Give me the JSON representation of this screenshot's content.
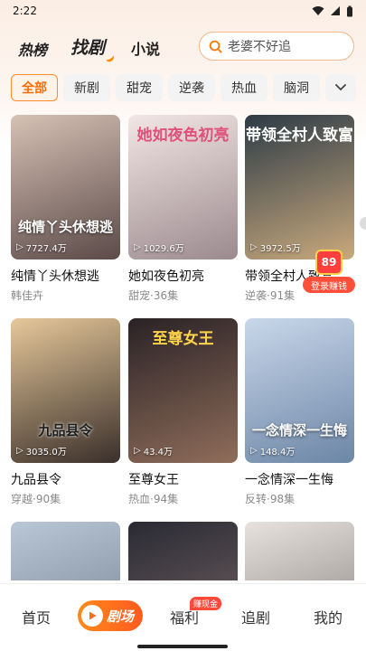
{
  "status": {
    "time": "2:22"
  },
  "header": {
    "tabs": [
      "热榜",
      "找剧",
      "小说"
    ],
    "search_placeholder": "老婆不好追"
  },
  "chips": [
    "全部",
    "新剧",
    "甜宠",
    "逆袭",
    "热血",
    "脑洞"
  ],
  "cards": [
    {
      "title": "纯情丫头休想逃",
      "meta": "韩佳卉",
      "views": "7727.4万",
      "poster_text": "纯情丫头休想逃",
      "colors": [
        "#d7c1b5",
        "#5b4a48"
      ]
    },
    {
      "title": "她如夜色初亮",
      "meta": "甜宠·36集",
      "views": "1029.6万",
      "poster_text": "她如夜色初亮",
      "colors": [
        "#f3e6e6",
        "#9b8a8e"
      ]
    },
    {
      "title": "带领全村人致富",
      "meta": "逆袭·91集",
      "views": "3972.5万",
      "poster_text": "带领全村人致富",
      "colors": [
        "#2d3b46",
        "#c9a97d"
      ]
    },
    {
      "title": "九品县令",
      "meta": "穿越·90集",
      "views": "3035.0万",
      "poster_text": "九品县令",
      "colors": [
        "#e6c89a",
        "#3a2f2a"
      ]
    },
    {
      "title": "至尊女王",
      "meta": "热血·94集",
      "views": "43.4万",
      "poster_text": "至尊女王",
      "colors": [
        "#2a2226",
        "#8f6d5a"
      ]
    },
    {
      "title": "一念情深一生悔",
      "meta": "反转·98集",
      "views": "148.4万",
      "poster_text": "一念情深一生悔",
      "colors": [
        "#c9d7ea",
        "#6c86a6"
      ]
    },
    {
      "title": "",
      "meta": "",
      "views": "",
      "poster_text": "",
      "colors": [
        "#b9c7d6",
        "#6f7d8e"
      ]
    },
    {
      "title": "",
      "meta": "",
      "views": "",
      "poster_text": "",
      "colors": [
        "#2a2a33",
        "#7a6a6a"
      ]
    },
    {
      "title": "",
      "meta": "",
      "views": "",
      "poster_text": "",
      "colors": [
        "#e8e2de",
        "#7f7a78"
      ]
    }
  ],
  "reward": {
    "count": "89",
    "label": "登录赚钱"
  },
  "nav": {
    "home": "首页",
    "theater": "剧场",
    "welfare": "福利",
    "welfare_badge": "赚现金",
    "follow": "追剧",
    "mine": "我的"
  },
  "accent_color": "#ff6d00"
}
